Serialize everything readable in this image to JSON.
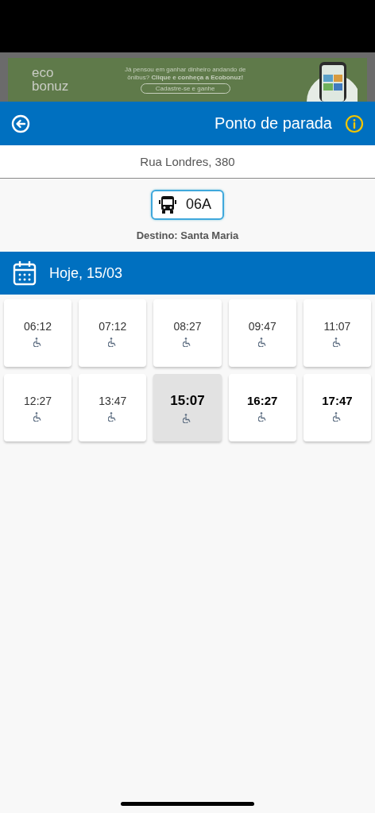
{
  "banner": {
    "logo_top": "eco",
    "logo_bottom": "bonuz",
    "text": "Já pensou em ganhar dinheiro andando de ônibus? **Clique e conheça a Ecobonuz!**",
    "button": "Cadastre-se e ganhe"
  },
  "header": {
    "title": "Ponto de parada"
  },
  "address": "Rua Londres, 380",
  "route": {
    "line": "06A",
    "destination": "Destino: Santa Maria"
  },
  "date_bar": {
    "label": "Hoje, 15/03"
  },
  "times": [
    {
      "time": "06:12",
      "selected": false,
      "past": true
    },
    {
      "time": "07:12",
      "selected": false,
      "past": true
    },
    {
      "time": "08:27",
      "selected": false,
      "past": true
    },
    {
      "time": "09:47",
      "selected": false,
      "past": true
    },
    {
      "time": "11:07",
      "selected": false,
      "past": true
    },
    {
      "time": "12:27",
      "selected": false,
      "past": true
    },
    {
      "time": "13:47",
      "selected": false,
      "past": true
    },
    {
      "time": "15:07",
      "selected": true,
      "past": false
    },
    {
      "time": "16:27",
      "selected": false,
      "past": false
    },
    {
      "time": "17:47",
      "selected": false,
      "past": false
    }
  ]
}
